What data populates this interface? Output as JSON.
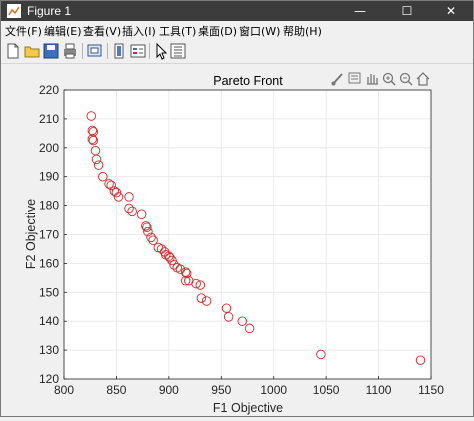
{
  "window": {
    "title": "Figure 1",
    "minimize": "—",
    "maximize": "☐",
    "close": "✕"
  },
  "menu": [
    {
      "label": "文件(F)"
    },
    {
      "label": "编辑(E)"
    },
    {
      "label": "查看(V)"
    },
    {
      "label": "插入(I)"
    },
    {
      "label": "工具(T)"
    },
    {
      "label": "桌面(D)"
    },
    {
      "label": "窗口(W)"
    },
    {
      "label": "帮助(H)"
    }
  ],
  "toolbar_icons": [
    "new-figure-icon",
    "open-file-icon",
    "save-icon",
    "print-icon",
    "link-plot-icon",
    "insert-colorbar-icon",
    "insert-legend-icon",
    "edit-plot-icon",
    "property-inspector-icon"
  ],
  "axes_toolbar_icons": [
    "brush-icon",
    "data-tip-icon",
    "pan-icon",
    "zoom-in-icon",
    "zoom-out-icon",
    "home-icon"
  ],
  "colors": {
    "marker": "#d62728",
    "axes_bg": "#ffffff",
    "grid": "#e6e6e6"
  },
  "chart_data": {
    "type": "scatter",
    "title": "Pareto Front",
    "xlabel": "F1 Objective",
    "ylabel": "F2 Objective",
    "xlim": [
      800,
      1150
    ],
    "ylim": [
      120,
      220
    ],
    "xticks": [
      "800",
      "850",
      "900",
      "950",
      "1000",
      "1050",
      "1100",
      "1150"
    ],
    "yticks": [
      "120",
      "130",
      "140",
      "150",
      "160",
      "170",
      "180",
      "190",
      "200",
      "210",
      "220"
    ],
    "grid": true,
    "marker": "open-circle",
    "points": [
      [
        826,
        211
      ],
      [
        827,
        206
      ],
      [
        828,
        205.5
      ],
      [
        827,
        203
      ],
      [
        828,
        202.5
      ],
      [
        830,
        199
      ],
      [
        831,
        196
      ],
      [
        833,
        194
      ],
      [
        837,
        190
      ],
      [
        843,
        187.5
      ],
      [
        845,
        187
      ],
      [
        848,
        185
      ],
      [
        850,
        184.5
      ],
      [
        852,
        183
      ],
      [
        862,
        183
      ],
      [
        862,
        179
      ],
      [
        865,
        178
      ],
      [
        874,
        177
      ],
      [
        878,
        173
      ],
      [
        879,
        172.5
      ],
      [
        880,
        171
      ],
      [
        883,
        169
      ],
      [
        885,
        168
      ],
      [
        890,
        165.5
      ],
      [
        893,
        165
      ],
      [
        896,
        164
      ],
      [
        897,
        163
      ],
      [
        900,
        162.5
      ],
      [
        901,
        162
      ],
      [
        903,
        161
      ],
      [
        905,
        159.5
      ],
      [
        908,
        158.5
      ],
      [
        911,
        158
      ],
      [
        916,
        157
      ],
      [
        917,
        156.5
      ],
      [
        916,
        154
      ],
      [
        919,
        154
      ],
      [
        926,
        153
      ],
      [
        930,
        152.5
      ],
      [
        931,
        148
      ],
      [
        936,
        147
      ],
      [
        955,
        144.5
      ],
      [
        957,
        141.5
      ],
      [
        970,
        140
      ],
      [
        977,
        137.5
      ],
      [
        1045,
        128.5
      ],
      [
        1140,
        126.5
      ]
    ]
  }
}
